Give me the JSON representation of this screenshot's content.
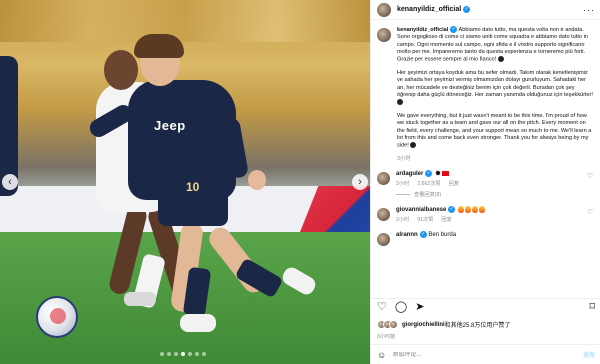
{
  "photo": {
    "shirt_sponsor": "Jeep",
    "shirt_number": "10"
  },
  "header": {
    "username": "kenanyildiz_official",
    "more_icon": "more-horizontal-icon"
  },
  "caption": {
    "username": "kenanyildiz_official",
    "p1": "Abbiamo dato tutto, ma questa volta non è andata. Sono orgoglioso di come ci siamo uniti come squadra e abbiamo dato tutto in campo. Ogni momento sul campo, ogni sfida e il vostro supporto significano molto per me. Impareremo tanto da questa esperienza e torneremo più forti. Grazie per essere sempre al mio fianco!",
    "p2": "Her şeyimizi ortaya koyduk ama bu sefer olmadı. Takım olarak kenetlenişimiz ve sahada her şeyimizi vermiş olmamızdan dolayı gururluyum. Sahadaki her an, her mücadele ve desteğiniz benim için çok değerli. Buradan çok şey öğrenip daha güçlü döneceğiz. Her zaman yanımda olduğunuz için teşekkürler!",
    "p3": "We gave everything, but it just wasn't meant to be this time. I'm proud of how we stuck together as a team and gave our all on the pitch. Every moment on the field, every challenge, and your support mean so much to me. We'll learn a lot from this and come back even stronger. Thank you for always being by my side!",
    "time": "3小时"
  },
  "comments": [
    {
      "username": "ardaguler",
      "time": "2小时",
      "likes": "2,662次赞",
      "reply": "回复",
      "view_replies": "查看回复(8)"
    },
    {
      "username": "giovannialbanese",
      "time": "2小时",
      "likes": "91次赞",
      "reply": "回复"
    },
    {
      "username": "alrannn",
      "text": "Ben burda"
    }
  ],
  "likes": {
    "text_user": "giorgiochiellini",
    "text_rest": "和其他25.8万位用户赞了"
  },
  "post_time": "3小时前",
  "composer": {
    "placeholder": "添加评论...",
    "post_label": "发布"
  }
}
